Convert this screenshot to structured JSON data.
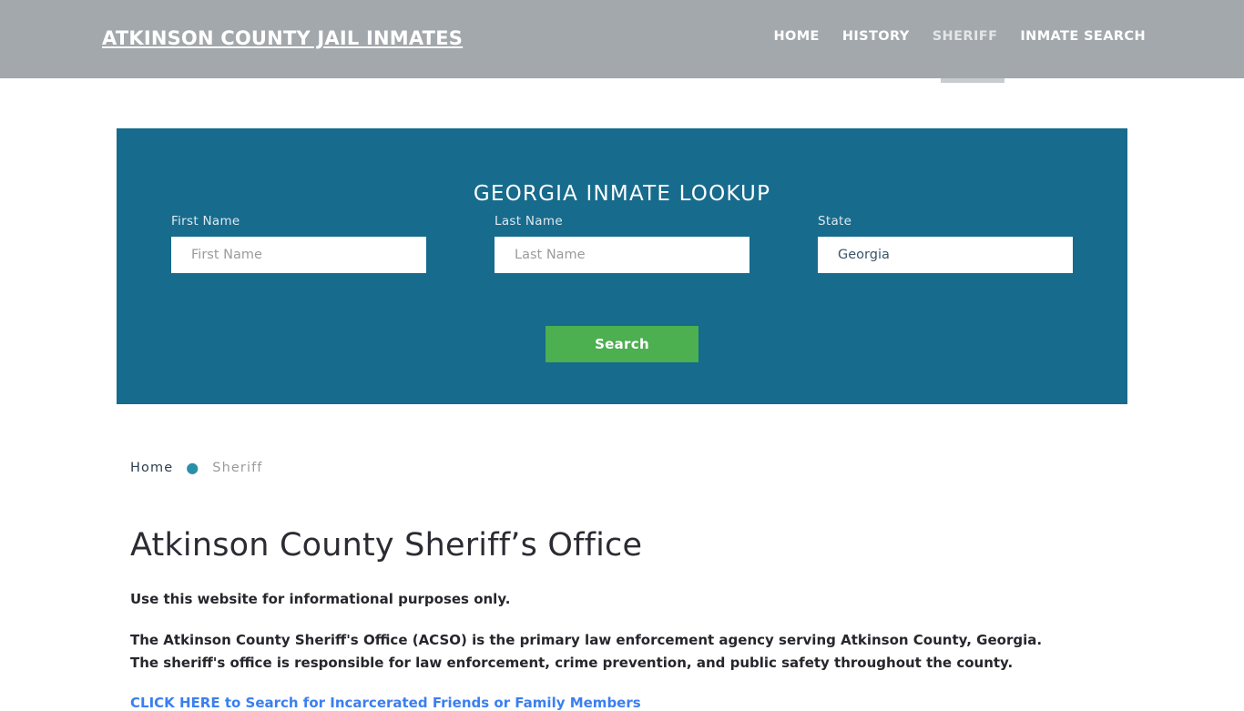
{
  "header": {
    "brand": "ATKINSON COUNTY JAIL INMATES",
    "nav": [
      {
        "label": "HOME",
        "active": false
      },
      {
        "label": "HISTORY",
        "active": false
      },
      {
        "label": "SHERIFF",
        "active": true
      },
      {
        "label": "INMATE SEARCH",
        "active": false
      }
    ]
  },
  "lookup": {
    "title": "GEORGIA INMATE LOOKUP",
    "first_name_label": "First Name",
    "first_name_placeholder": "First Name",
    "first_name_value": "",
    "last_name_label": "Last Name",
    "last_name_placeholder": "Last Name",
    "last_name_value": "",
    "state_label": "State",
    "state_value": "Georgia",
    "state_options": [
      "Georgia"
    ],
    "search_label": "Search"
  },
  "breadcrumb": {
    "home": "Home",
    "separator": "●",
    "current": "Sheriff"
  },
  "main": {
    "title": "Atkinson County Sheriff’s Office",
    "lead": "Use this website for informational purposes only.",
    "paragraph": "The Atkinson County Sheriff's Office (ACSO) is the primary law enforcement agency serving Atkinson County, Georgia. The sheriff's office is responsible for law enforcement, crime prevention, and public safety throughout the county.",
    "cta_link": "CLICK HERE to Search for Incarcerated Friends or Family Members"
  },
  "colors": {
    "header_gray": "#a2a8ac",
    "panel_teal": "#176b8d",
    "button_green": "#4caf50",
    "link_blue": "#3b7ff0",
    "breadcrumb_dot": "#2a8fa8"
  }
}
